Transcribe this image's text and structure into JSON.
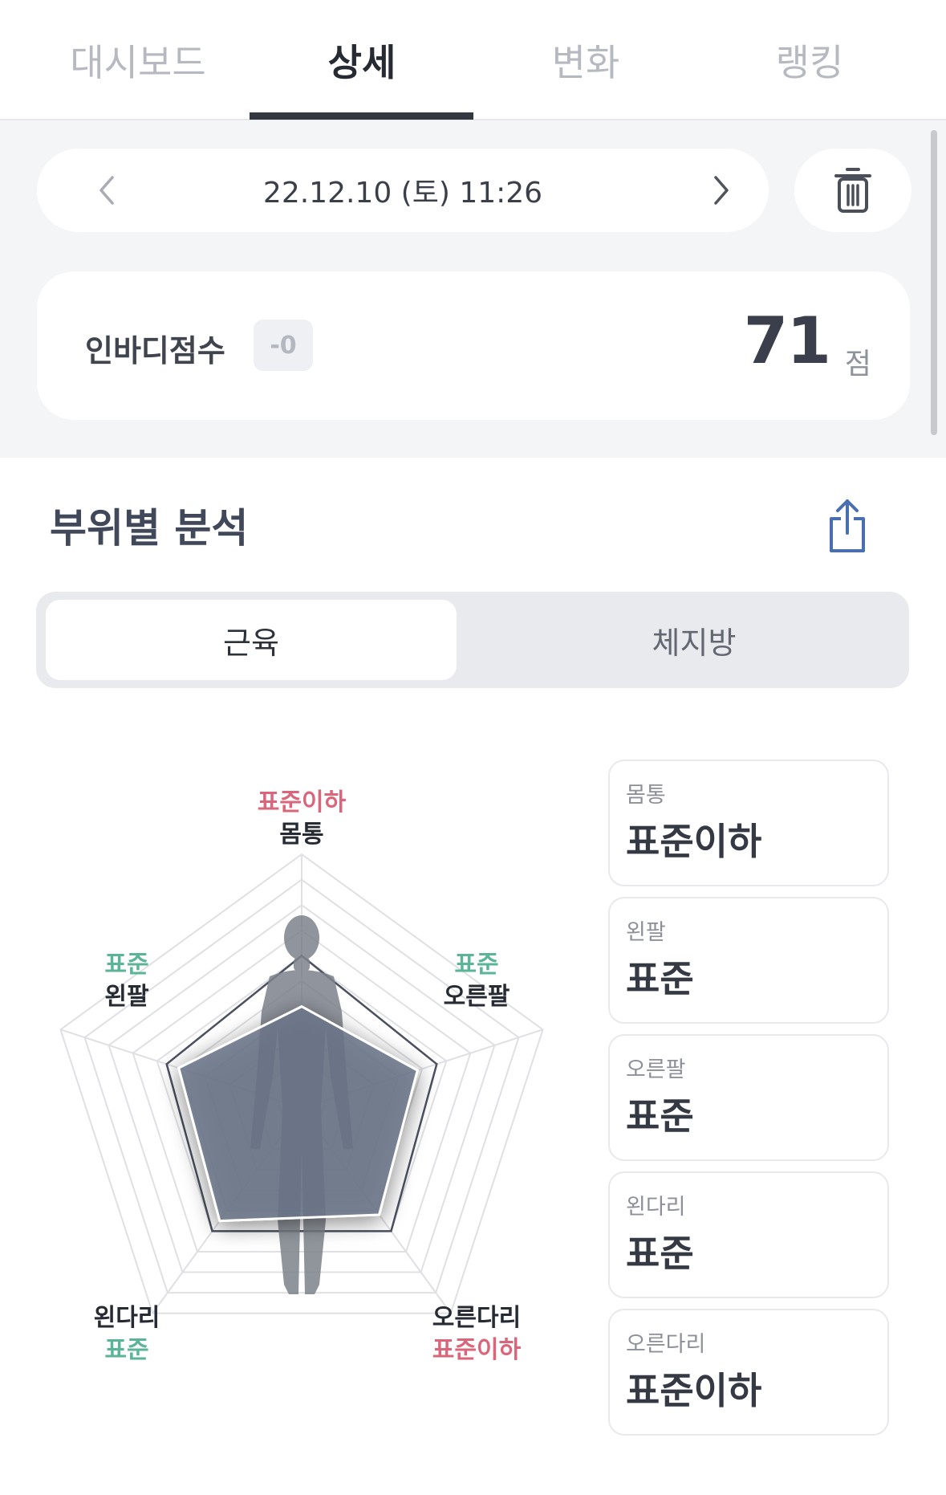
{
  "tabs": [
    {
      "label": "대시보드"
    },
    {
      "label": "상세"
    },
    {
      "label": "변화"
    },
    {
      "label": "랭킹"
    }
  ],
  "date_nav": {
    "date": "22.12.10 (토) 11:26",
    "prev_icon": "chevron-left-icon",
    "next_icon": "chevron-right-icon",
    "delete_icon": "trash-icon"
  },
  "score": {
    "label": "인바디점수",
    "change": "-0",
    "value": "71",
    "unit": "점"
  },
  "section": {
    "title": "부위별 분석",
    "share_icon": "share-icon"
  },
  "segment": {
    "options": [
      {
        "label": "근육"
      },
      {
        "label": "체지방"
      }
    ]
  },
  "radar": {
    "labels": {
      "trunk": {
        "status": "표준이하",
        "name": "몸통"
      },
      "left_arm": {
        "status": "표준",
        "name": "왼팔"
      },
      "right_arm": {
        "status": "표준",
        "name": "오른팔"
      },
      "left_leg": {
        "name": "왼다리",
        "status": "표준"
      },
      "right_leg": {
        "name": "오른다리",
        "status": "표준이하"
      }
    },
    "colors": {
      "below_standard": "#d9667a",
      "standard": "#5bb595",
      "fill": "#6b7688"
    }
  },
  "cards": [
    {
      "title": "몸통",
      "value": "표준이하"
    },
    {
      "title": "왼팔",
      "value": "표준"
    },
    {
      "title": "오른팔",
      "value": "표준"
    },
    {
      "title": "왼다리",
      "value": "표준"
    },
    {
      "title": "오른다리",
      "value": "표준이하"
    }
  ]
}
